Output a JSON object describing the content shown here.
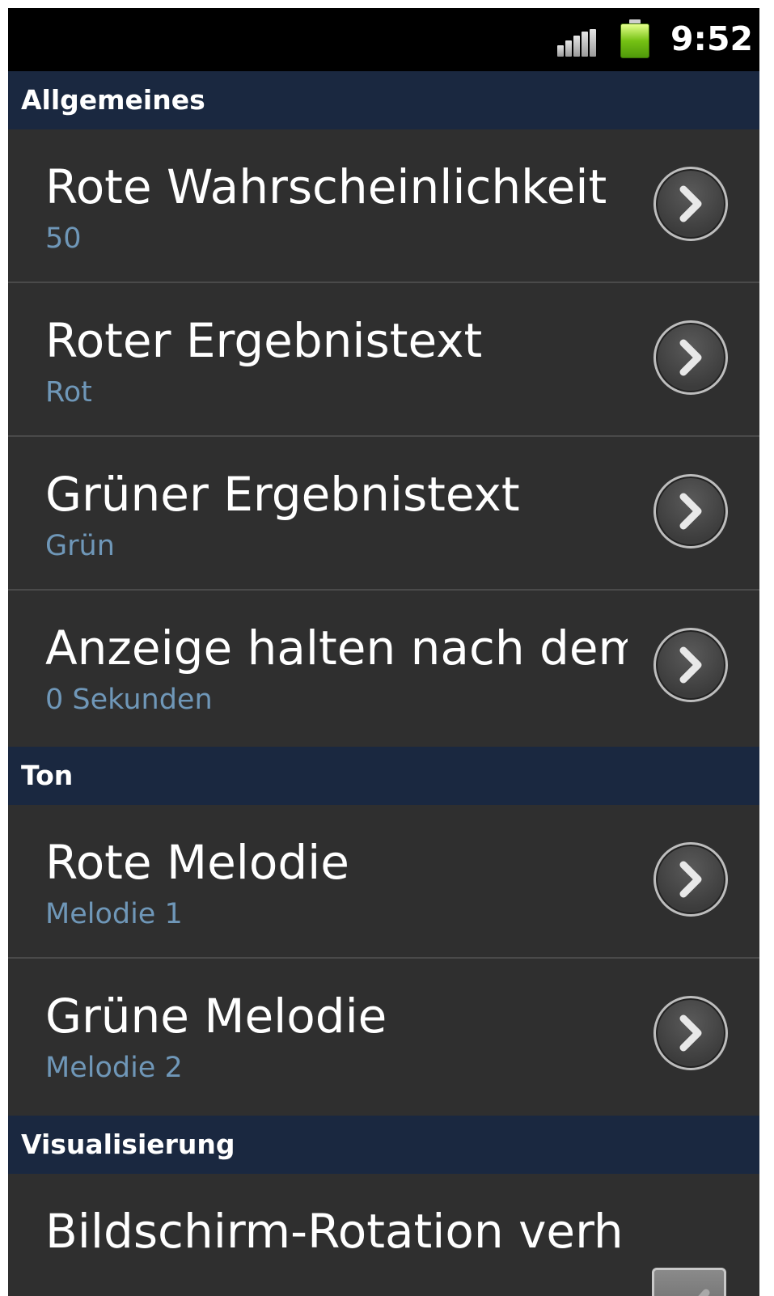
{
  "statusbar": {
    "time": "9:52",
    "icons": [
      "signal-icon",
      "battery-icon"
    ]
  },
  "sections": [
    {
      "header": "Allgemeines",
      "items": [
        {
          "title": "Rote Wahrscheinlichkeit",
          "summary": "50",
          "icon": "chevron-right-icon"
        },
        {
          "title": "Roter Ergebnistext",
          "summary": "Rot",
          "icon": "chevron-right-icon"
        },
        {
          "title": "Grüner Ergebnistext",
          "summary": "Grün",
          "icon": "chevron-right-icon"
        },
        {
          "title": "Anzeige halten nach dem",
          "summary": "0 Sekunden",
          "icon": "chevron-right-icon"
        }
      ]
    },
    {
      "header": "Ton",
      "items": [
        {
          "title": "Rote Melodie",
          "summary": "Melodie 1",
          "icon": "chevron-right-icon"
        },
        {
          "title": "Grüne Melodie",
          "summary": "Melodie 2",
          "icon": "chevron-right-icon"
        }
      ]
    },
    {
      "header": "Visualisierung",
      "items": [
        {
          "title": "Bildschirm-Rotation verh",
          "checked": true,
          "icon": "checkbox-icon"
        }
      ]
    }
  ],
  "colors": {
    "background": "#2f2f2f",
    "section_header": "#1a2840",
    "summary_text": "#6f97b8",
    "title_text": "#ffffff",
    "statusbar": "#000000",
    "battery": "#76c214"
  }
}
